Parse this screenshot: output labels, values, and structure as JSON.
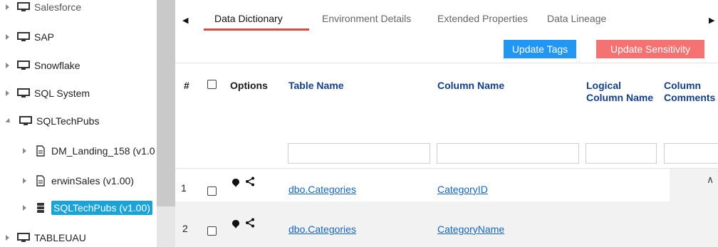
{
  "tree": {
    "items": [
      {
        "label": "Salesforce",
        "icon": "monitor-icon"
      },
      {
        "label": "SAP",
        "icon": "monitor-icon"
      },
      {
        "label": "Snowflake",
        "icon": "monitor-icon"
      },
      {
        "label": "SQL System",
        "icon": "monitor-icon"
      },
      {
        "label": "SQLTechPubs",
        "icon": "monitor-icon",
        "expanded": true
      },
      {
        "label": "DM_Landing_158 (v1.0",
        "icon": "document-icon"
      },
      {
        "label": "erwinSales (v1.00)",
        "icon": "document-icon"
      },
      {
        "label": "SQLTechPubs (v1.00)",
        "icon": "database-icon",
        "selected": true
      },
      {
        "label": "TABLEUAU",
        "icon": "monitor-icon"
      }
    ]
  },
  "tabs": [
    "Data Dictionary",
    "Environment Details",
    "Extended Properties",
    "Data Lineage"
  ],
  "active_tab": "Data Dictionary",
  "buttons": {
    "update_tags": "Update Tags",
    "update_sensitivity": "Update Sensitivity"
  },
  "table": {
    "headers": {
      "num": "#",
      "options": "Options",
      "table_name": "Table Name",
      "column_name": "Column Name",
      "logical_1": "Logical",
      "logical_2": "Column Name",
      "comments_1": "Column",
      "comments_2": "Comments"
    },
    "rows": [
      {
        "num": "1",
        "table_name": "dbo.Categories",
        "column_name": "CategoryID"
      },
      {
        "num": "2",
        "table_name": "dbo.Categories",
        "column_name": "CategoryName"
      }
    ]
  },
  "colors": {
    "accent": "#2196f3",
    "danger": "#f47272",
    "selected": "#1aa3d6",
    "tab_underline": "#e8473a",
    "link": "#1565c0"
  }
}
